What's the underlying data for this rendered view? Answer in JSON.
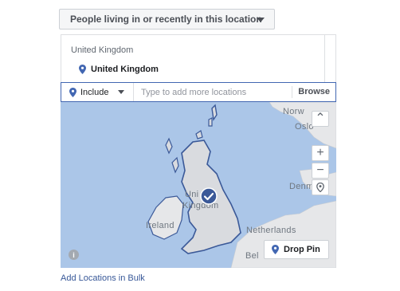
{
  "audience_type": {
    "label": "People living in or recently in this location"
  },
  "location_list": {
    "heading": "United Kingdom",
    "selected": "United Kingdom"
  },
  "location_search": {
    "mode": "Include",
    "placeholder": "Type to add more locations",
    "browse_label": "Browse"
  },
  "map": {
    "labels": {
      "norway": "Norw",
      "oslo": "Oslo",
      "denmark": "Denm",
      "united_kingdom_top": "Uni",
      "united_kingdom_bottom": "Kingdom",
      "ireland": "Ireland",
      "netherlands": "Netherlands",
      "belgium": "Bel"
    },
    "drop_pin_label": "Drop Pin",
    "info_glyph": "i",
    "zoom_in_glyph": "+",
    "zoom_out_glyph": "−",
    "collapse_glyph": "⌃"
  },
  "bulk_action": {
    "label": "Add Locations in Bulk"
  },
  "colors": {
    "accent": "#4267b2",
    "link": "#385898",
    "water": "#abc6e8",
    "land": "#e6e7e9",
    "target_region": "#3b5998"
  },
  "icons": [
    "chevron-down-icon",
    "location-pin-icon",
    "checkmark-marker-icon",
    "info-icon",
    "plus-icon",
    "minus-icon",
    "collapse-up-icon",
    "location-target-icon"
  ]
}
